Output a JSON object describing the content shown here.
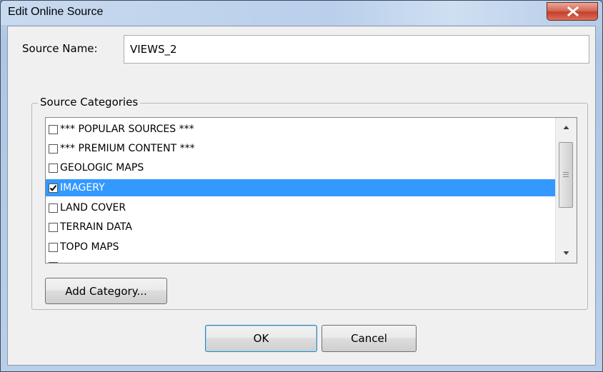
{
  "window": {
    "title": "Edit Online Source",
    "close_icon": "close-icon",
    "colors": {
      "selection": "#3399ff",
      "close": "#c4402c"
    }
  },
  "source_name": {
    "label": "Source Name:",
    "value": "VIEWS_2"
  },
  "categories": {
    "legend": "Source Categories",
    "items": [
      {
        "label": "*** POPULAR SOURCES ***",
        "checked": false,
        "selected": false
      },
      {
        "label": "*** PREMIUM CONTENT ***",
        "checked": false,
        "selected": false
      },
      {
        "label": "GEOLOGIC MAPS",
        "checked": false,
        "selected": false
      },
      {
        "label": "IMAGERY",
        "checked": true,
        "selected": true
      },
      {
        "label": "LAND COVER",
        "checked": false,
        "selected": false
      },
      {
        "label": "TERRAIN DATA",
        "checked": false,
        "selected": false
      },
      {
        "label": "TOPO MAPS",
        "checked": false,
        "selected": false
      }
    ],
    "add_button": "Add Category..."
  },
  "buttons": {
    "ok": "OK",
    "cancel": "Cancel"
  }
}
